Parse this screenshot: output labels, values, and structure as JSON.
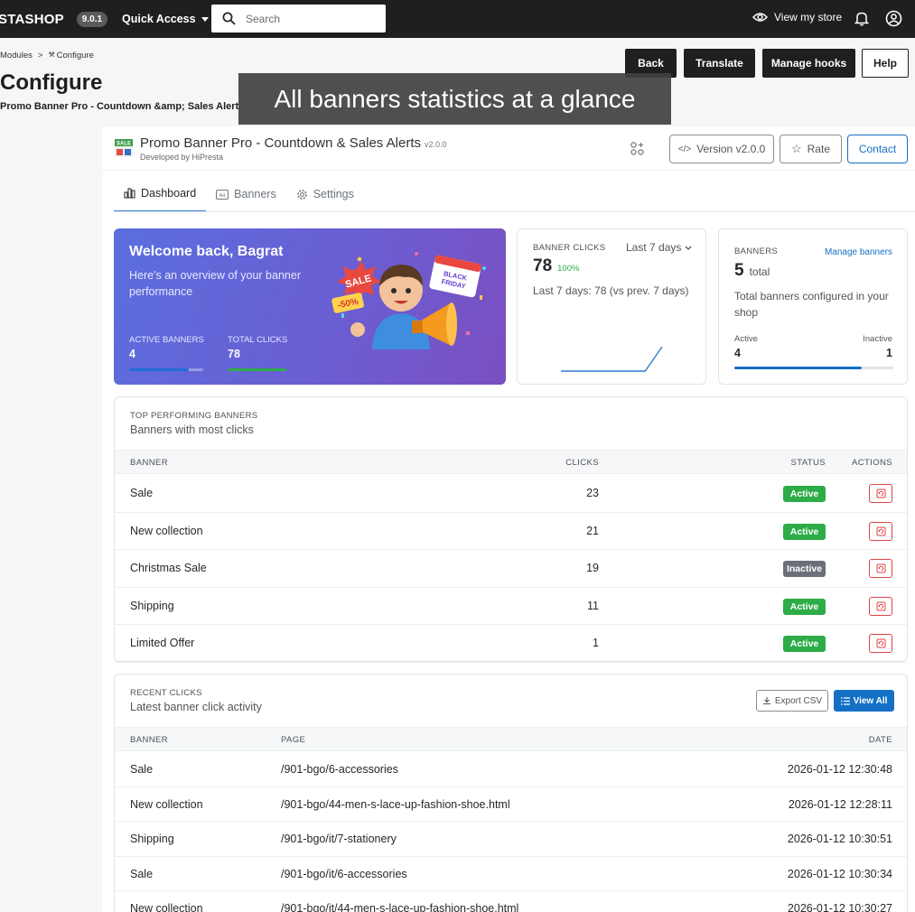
{
  "topbar": {
    "brand": "STASHOP",
    "version": "9.0.1",
    "quick_access": "Quick Access",
    "search_placeholder": "Search",
    "view_store": "View my store"
  },
  "header": {
    "breadcrumb": [
      "Modules",
      "Configure"
    ],
    "title": "Configure",
    "subtitle": "Promo Banner Pro - Countdown &amp; Sales Alert",
    "buttons": {
      "back": "Back",
      "translate": "Translate",
      "manage_hooks": "Manage hooks",
      "help": "Help"
    }
  },
  "overlay_caption": "All banners statistics at a glance",
  "module": {
    "name": "Promo Banner Pro - Countdown & Sales Alerts",
    "version_small": "v2.0.0",
    "developer": "Developed by HiPresta",
    "version_button": "Version v2.0.0",
    "rate_button": "Rate",
    "contact_button": "Contact",
    "logo_text": "SALE"
  },
  "tabs": [
    {
      "label": "Dashboard",
      "active": true
    },
    {
      "label": "Banners",
      "active": false
    },
    {
      "label": "Settings",
      "active": false
    }
  ],
  "welcome": {
    "title": "Welcome back, Bagrat",
    "text": "Here's an overview of your banner performance",
    "active_label": "ACTIVE BANNERS",
    "active_value": "4",
    "clicks_label": "TOTAL CLICKS",
    "clicks_value": "78",
    "illustration": {
      "sale": "SALE",
      "discount": "-50%",
      "tag1": "BLACK",
      "tag2": "FRIDAY"
    }
  },
  "clicks_card": {
    "caption": "BANNER CLICKS",
    "period": "Last 7 days",
    "value": "78",
    "change": "100%",
    "note": "Last 7 days: 78 (vs prev. 7 days)",
    "sparkline": [
      0,
      0,
      0,
      0,
      0,
      0,
      78
    ]
  },
  "banners_card": {
    "caption": "BANNERS",
    "link": "Manage banners",
    "total": "5",
    "total_label": "total",
    "note": "Total banners configured in your shop",
    "active_label": "Active",
    "active": "4",
    "inactive_label": "Inactive",
    "inactive": "1",
    "active_fraction": 0.8
  },
  "top_banners": {
    "caption": "TOP PERFORMING BANNERS",
    "subtitle": "Banners with most clicks",
    "headers": {
      "banner": "BANNER",
      "clicks": "CLICKS",
      "status": "STATUS",
      "actions": "ACTIONS"
    },
    "rows": [
      {
        "name": "Sale",
        "clicks": "23",
        "status": "Active"
      },
      {
        "name": "New collection",
        "clicks": "21",
        "status": "Active"
      },
      {
        "name": "Christmas Sale",
        "clicks": "19",
        "status": "Inactive"
      },
      {
        "name": "Shipping",
        "clicks": "11",
        "status": "Active"
      },
      {
        "name": "Limited Offer",
        "clicks": "1",
        "status": "Active"
      }
    ]
  },
  "recent_clicks": {
    "caption": "RECENT CLICKS",
    "subtitle": "Latest banner click activity",
    "export": "Export CSV",
    "view_all": "View All",
    "headers": {
      "banner": "BANNER",
      "page": "PAGE",
      "date": "DATE"
    },
    "rows": [
      {
        "banner": "Sale",
        "page": "/901-bgo/6-accessories",
        "date": "2026-01-12 12:30:48"
      },
      {
        "banner": "New collection",
        "page": "/901-bgo/44-men-s-lace-up-fashion-shoe.html",
        "date": "2026-01-12 12:28:11"
      },
      {
        "banner": "Shipping",
        "page": "/901-bgo/it/7-stationery",
        "date": "2026-01-12 10:30:51"
      },
      {
        "banner": "Sale",
        "page": "/901-bgo/it/6-accessories",
        "date": "2026-01-12 10:30:34"
      },
      {
        "banner": "New collection",
        "page": "/901-bgo/it/44-men-s-lace-up-fashion-shoe.html",
        "date": "2026-01-12 10:30:27"
      }
    ]
  },
  "colors": {
    "topbar": "#1f1f1f",
    "primary": "#1570c5",
    "active": "#2dac47",
    "inactive": "#6b6f79",
    "welcome_from": "#5b6fdd",
    "welcome_to": "#7b4fc0"
  }
}
